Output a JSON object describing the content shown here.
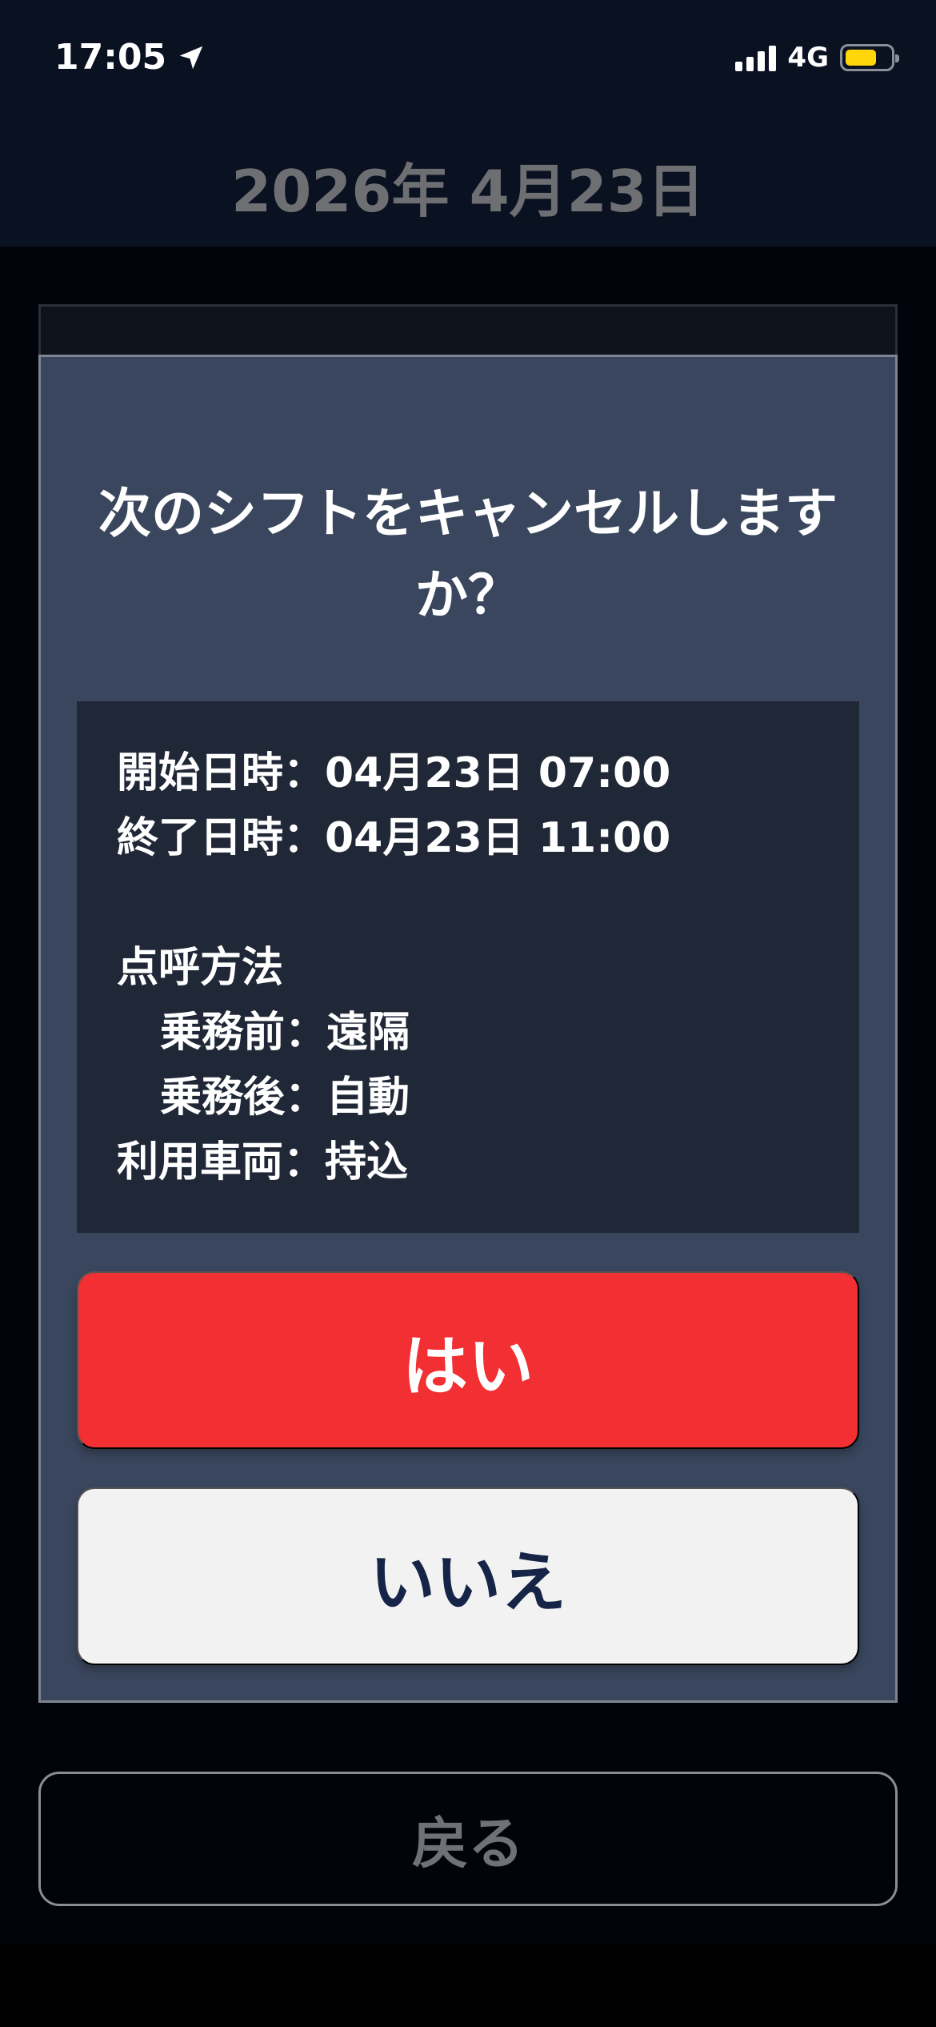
{
  "status_bar": {
    "time": "17:05",
    "network": "4G",
    "location_icon": "location-arrow-icon",
    "battery_color": "#ffd60a"
  },
  "header": {
    "date": "2026年 4月23日"
  },
  "dialog": {
    "title": "次のシフトをキャンセルしますか？",
    "details": {
      "start": "開始日時：04月23日 07:00",
      "end": "終了日時：04月23日 11:00",
      "roll_call_heading": "点呼方法",
      "before_duty": "乗務前：遠隔",
      "after_duty": "乗務後：自動",
      "vehicle": "利用車両：持込"
    },
    "yes_label": "はい",
    "no_label": "いいえ"
  },
  "footer": {
    "back_label": "戻る"
  },
  "colors": {
    "background": "#02040b",
    "header_bg": "#0a1120",
    "modal_bg": "#39465d",
    "details_bg": "#202837",
    "yes_bg": "#f22f32",
    "no_bg": "#f2f2f2",
    "no_text": "#152447"
  }
}
